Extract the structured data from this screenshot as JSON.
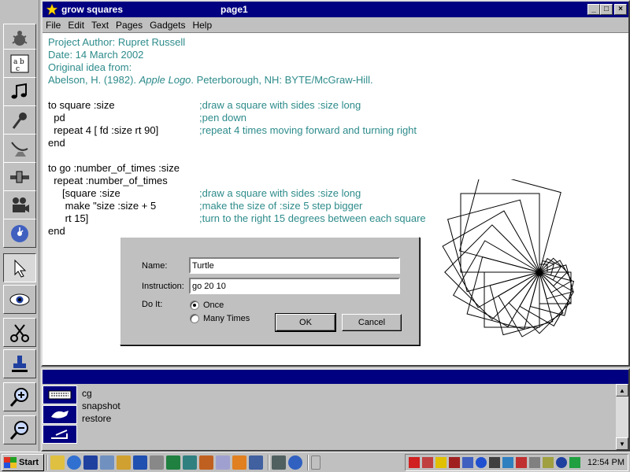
{
  "window": {
    "app_title": "grow squares",
    "page_title": "page1",
    "minimize_glyph": "_",
    "maximize_glyph": "□",
    "close_glyph": "×"
  },
  "menu": [
    "File",
    "Edit",
    "Text",
    "Pages",
    "Gadgets",
    "Help"
  ],
  "document": {
    "header": [
      "Project Author: Rupret Russell",
      "Date: 14 March 2002",
      "Original idea from:"
    ],
    "citation_author": "Abelson, H. (1982). ",
    "citation_title": "Apple Logo",
    "citation_rest": ". Peterborough, NH: BYTE/McGraw-Hill.",
    "code": [
      {
        "code": "to square :size",
        "comment": ";draw a square with sides :size long"
      },
      {
        "code": "  pd",
        "comment": ";pen down"
      },
      {
        "code": "  repeat 4 [ fd :size rt 90]",
        "comment": ";repeat 4 times moving forward and turning right"
      },
      {
        "code": "end",
        "comment": ""
      },
      {
        "code": "",
        "comment": ""
      },
      {
        "code": "to go :number_of_times :size",
        "comment": ""
      },
      {
        "code": "  repeat :number_of_times",
        "comment": ""
      },
      {
        "code": "     [square :size",
        "comment": ";draw a square with sides :size long"
      },
      {
        "code": "      make \"size :size + 5",
        "comment": ";make the size of :size 5 step bigger"
      },
      {
        "code": "      rt 15]",
        "comment": ";turn to the right 15 degrees between each square"
      },
      {
        "code": "end",
        "comment": ""
      }
    ]
  },
  "dialog": {
    "name_label": "Name:",
    "name_value": "Turtle",
    "instruction_label": "Instruction:",
    "instruction_value": "go 20 10",
    "doit_label": "Do It:",
    "once_label": "Once",
    "many_label": "Many Times",
    "ok_label": "OK",
    "cancel_label": "Cancel",
    "selected": "Once"
  },
  "command_panel": {
    "lines": [
      "cg",
      "snapshot",
      "restore"
    ]
  },
  "taskbar": {
    "start_label": "Start",
    "clock": "12:54 PM"
  },
  "colors": {
    "titlebar": "#000080",
    "doc_text": "#2e8b8b"
  },
  "palette_icons": [
    "turtle-icon",
    "text-icon",
    "music-icon",
    "microphone-icon",
    "satellite-icon",
    "slider-icon",
    "camera-icon",
    "cd-icon",
    "pointer-icon",
    "eye-icon",
    "scissors-icon",
    "stamp-icon",
    "zoom-in-icon",
    "zoom-out-icon"
  ]
}
